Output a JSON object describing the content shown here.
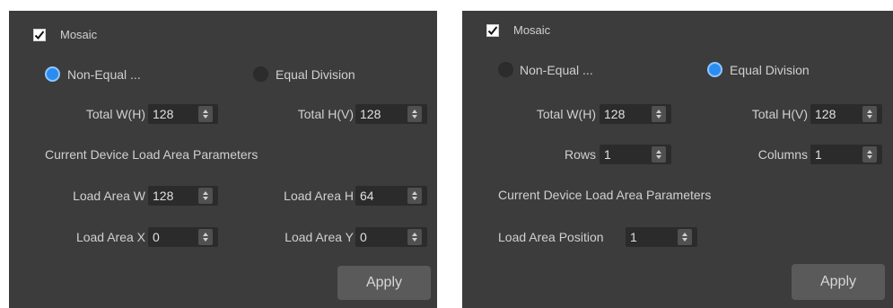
{
  "left": {
    "mosaic_label": "Mosaic",
    "radio_non_equal": "Non-Equal ...",
    "radio_equal": "Equal Division",
    "total_w_label": "Total W(H)",
    "total_w_value": "128",
    "total_h_label": "Total H(V)",
    "total_h_value": "128",
    "section_title": "Current Device Load Area Parameters",
    "load_w_label": "Load Area W",
    "load_w_value": "128",
    "load_h_label": "Load Area H",
    "load_h_value": "64",
    "load_x_label": "Load Area X",
    "load_x_value": "0",
    "load_y_label": "Load Area Y",
    "load_y_value": "0",
    "apply_label": "Apply"
  },
  "right": {
    "mosaic_label": "Mosaic",
    "radio_non_equal": "Non-Equal ...",
    "radio_equal": "Equal Division",
    "total_w_label": "Total W(H)",
    "total_w_value": "128",
    "total_h_label": "Total H(V)",
    "total_h_value": "128",
    "rows_label": "Rows",
    "rows_value": "1",
    "columns_label": "Columns",
    "columns_value": "1",
    "section_title": "Current Device Load Area Parameters",
    "position_label": "Load Area Position",
    "position_value": "1",
    "apply_label": "Apply"
  },
  "state": {
    "left_mosaic_checked": true,
    "left_selected_mode": "Non-Equal ...",
    "right_mosaic_checked": true,
    "right_selected_mode": "Equal Division"
  },
  "colors": {
    "panel_bg": "#3c3c3c",
    "input_bg": "#2b2b2b",
    "radio_selected": "#2a8cf0",
    "button_bg": "#5a5a5a"
  }
}
